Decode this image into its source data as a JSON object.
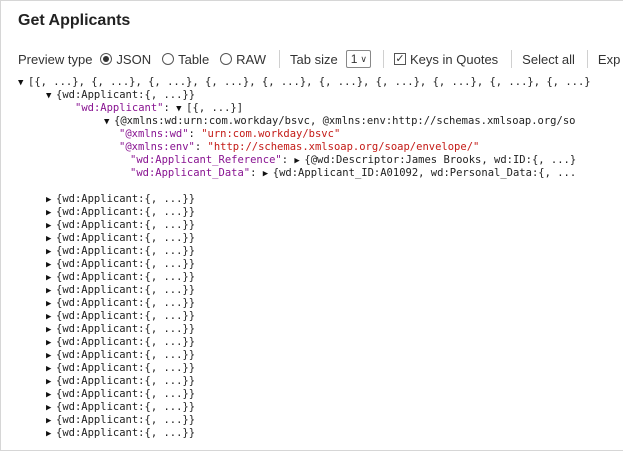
{
  "title": "Get Applicants",
  "toolbar": {
    "preview_label": "Preview type",
    "options": [
      "JSON",
      "Table",
      "RAW"
    ],
    "selected": "JSON",
    "tab_size_label": "Tab size",
    "tab_size_value": "1",
    "keys_in_quotes_label": "Keys in Quotes",
    "keys_in_quotes_checked": true,
    "select_all": "Select all",
    "expand": "Exp"
  },
  "tree": {
    "root": "[{, ...}, {, ...}, {, ...}, {, ...}, {, ...}, {, ...}, {, ...}, {, ...}, {, ...}, {, ...}",
    "first_item": "{wd:Applicant:{, ...}}",
    "applicant_key": "\"wd:Applicant\"",
    "applicant_value": "[{, ...}]",
    "obj_summary": "{@xmlns:wd:urn:com.workday/bsvc, @xmlns:env:http://schemas.xmlsoap.org/so",
    "xmlns_wd_key": "\"@xmlns:wd\"",
    "xmlns_wd_value": "\"urn:com.workday/bsvc\"",
    "xmlns_env_key": "\"@xmlns:env\"",
    "xmlns_env_value": "\"http://schemas.xmlsoap.org/soap/envelope/\"",
    "ref_key": "\"wd:Applicant_Reference\"",
    "ref_value": "{@wd:Descriptor:James Brooks, wd:ID:{, ...}",
    "data_key": "\"wd:Applicant_Data\"",
    "data_value": "{wd:Applicant_ID:A01092, wd:Personal_Data:{, ...",
    "collapsed_item": "{wd:Applicant:{, ...}}",
    "collapsed_count": 19
  }
}
